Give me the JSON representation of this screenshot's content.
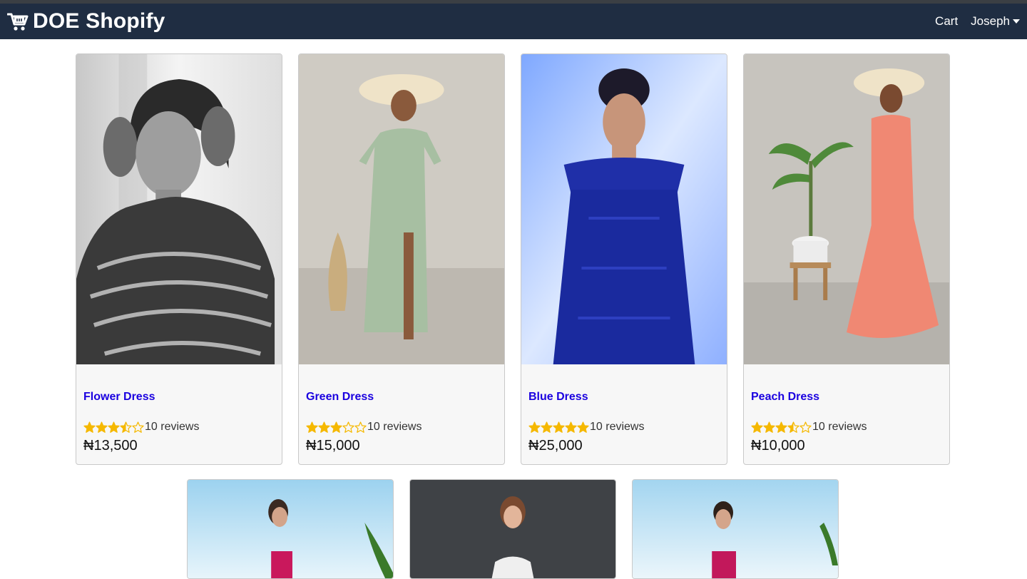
{
  "navbar": {
    "brand": "DOE Shopify",
    "cart_label": "Cart",
    "user_label": "Joseph",
    "brand_icon": "cart-icon"
  },
  "colors": {
    "navbar_bg": "#1f2d42",
    "title_link": "#1a00e0",
    "star": "#f5b800"
  },
  "products": [
    {
      "name": "Flower Dress",
      "rating": 3.5,
      "reviews": "10 reviews",
      "price": "₦13,500"
    },
    {
      "name": "Green Dress",
      "rating": 3,
      "reviews": "10 reviews",
      "price": "₦15,000"
    },
    {
      "name": "Blue Dress",
      "rating": 5,
      "reviews": "10 reviews",
      "price": "₦25,000"
    },
    {
      "name": "Peach Dress",
      "rating": 3.5,
      "reviews": "10 reviews",
      "price": "₦10,000"
    }
  ]
}
